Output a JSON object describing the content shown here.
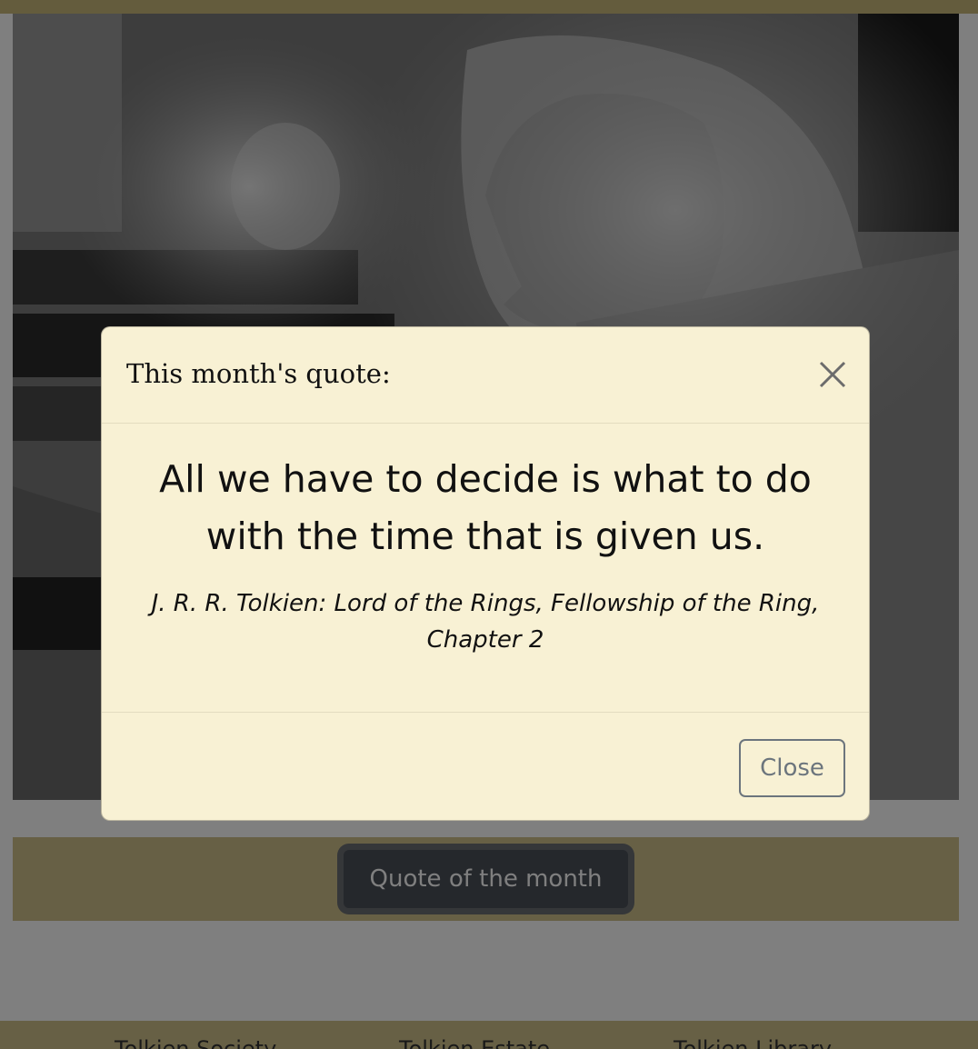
{
  "photo": {
    "subject_icon": "portrait-photo"
  },
  "quote_button_label": "Quote of the month",
  "footer": {
    "links": [
      "Tolkien Society",
      "Tolkien Estate",
      "Tolkien Library"
    ]
  },
  "modal": {
    "title": "This month's quote:",
    "quote": "All we have to decide is what to do with the time that is given us.",
    "source": "J. R. R. Tolkien: Lord of the Rings, Fellowship of the Ring, Chapter 2",
    "close_label": "Close",
    "close_icon": "close-icon"
  },
  "colors": {
    "accent": "#cfc18a",
    "modal_bg": "#f8f1d4",
    "button_dark": "#4a5059",
    "secondary": "#6c757d"
  }
}
